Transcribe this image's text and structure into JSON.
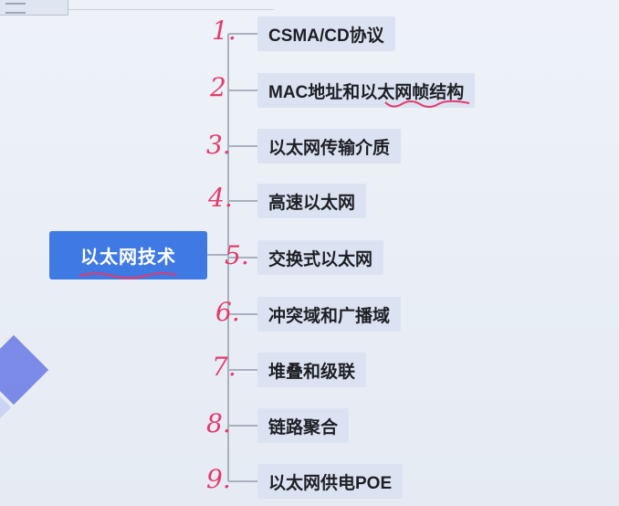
{
  "root": {
    "label": "以太网技术"
  },
  "items": [
    {
      "number": "1.",
      "label": "CSMA/CD协议"
    },
    {
      "number": "2",
      "label": "MAC地址和以太网帧结构"
    },
    {
      "number": "3.",
      "label": "以太网传输介质"
    },
    {
      "number": "4.",
      "label": "高速以太网"
    },
    {
      "number": "5.",
      "label": "交换式以太网"
    },
    {
      "number": "6.",
      "label": "冲突域和广播域"
    },
    {
      "number": "7.",
      "label": "堆叠和级联"
    },
    {
      "number": "8.",
      "label": "链路聚合"
    },
    {
      "number": "9.",
      "label": "以太网供电POE"
    }
  ],
  "colors": {
    "root_fill": "#3f79e3",
    "item_fill": "#dbe3f2",
    "annotation": "#e53a6a",
    "connector": "#a9b0be"
  }
}
